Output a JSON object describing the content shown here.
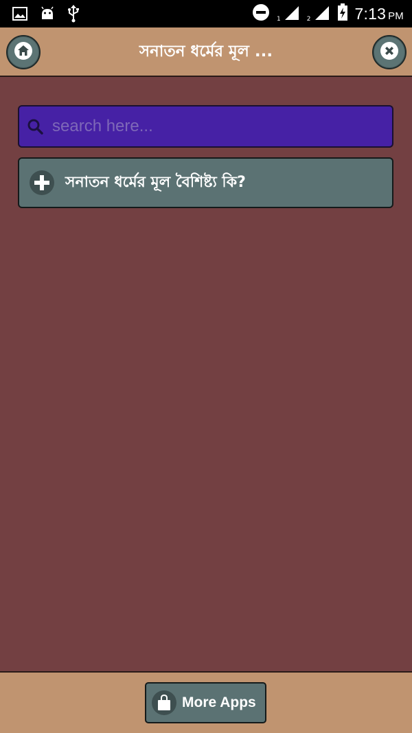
{
  "status_bar": {
    "time": "7:13",
    "ampm": "PM",
    "sim1_label": "1",
    "sim2_label": "2",
    "icons": [
      "image-icon",
      "android-icon",
      "usb-icon",
      "do-not-disturb-icon",
      "signal-icon",
      "signal-icon",
      "battery-icon"
    ]
  },
  "header": {
    "title": "সনাতন ধর্মের মূল ...",
    "home_icon": "home-icon",
    "close_icon": "close-icon"
  },
  "search": {
    "placeholder": "search here...",
    "value": "",
    "icon": "search-icon"
  },
  "list": {
    "items": [
      {
        "label": "সনাতন ধর্মের মূল বৈশিষ্ট্য কি?",
        "icon": "plus-icon"
      }
    ]
  },
  "footer": {
    "more_apps_label": "More Apps",
    "icon": "shopping-bag-icon"
  },
  "colors": {
    "background": "#734042",
    "header": "#c09470",
    "search": "#4621a5",
    "item": "#5b7273"
  }
}
